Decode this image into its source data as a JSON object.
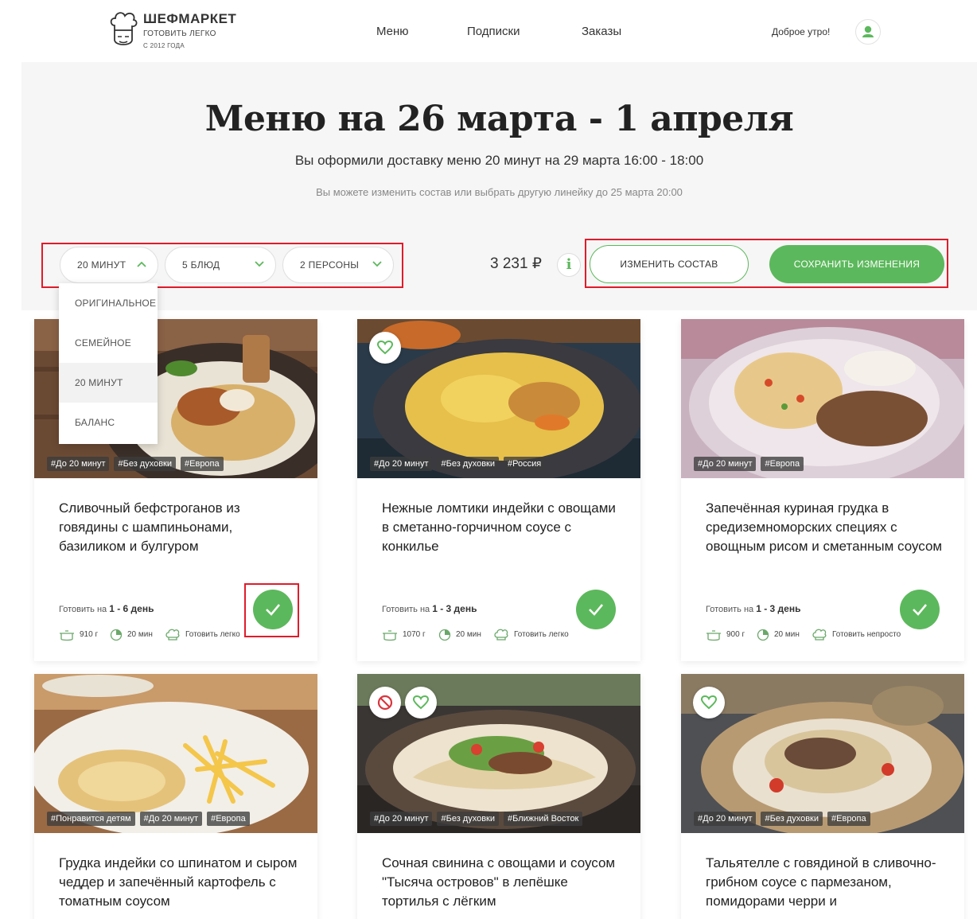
{
  "header": {
    "logo": {
      "name": "ШЕФМАРКЕТ",
      "tagline": "ГОТОВИТЬ ЛЕГКО",
      "since": "С 2012 ГОДА"
    },
    "nav": [
      {
        "label": "Меню"
      },
      {
        "label": "Подписки"
      },
      {
        "label": "Заказы"
      }
    ],
    "greeting": "Доброе утро!"
  },
  "hero": {
    "title": "Меню на 26 марта - 1 апреля",
    "delivery_text": "Вы оформили доставку меню 20 минут на 29 марта 16:00 - 18:00",
    "deadline_text": "Вы можете изменить состав или выбрать другую линейку до 25 марта 20:00"
  },
  "controls": {
    "menu_line": "20 МИНУТ",
    "dishes": "5 БЛЮД",
    "persons": "2 ПЕРСОНЫ",
    "price": "3 231 ₽",
    "info_label": "i",
    "change_button": "ИЗМЕНИТЬ СОСТАВ",
    "save_button": "СОХРАНИТЬ ИЗМЕНЕНИЯ"
  },
  "dropdown": {
    "options": [
      "ОРИГИНАЛЬНОЕ",
      "СЕМЕЙНОЕ",
      "20 МИНУТ",
      "БАЛАНС"
    ],
    "selected": "20 МИНУТ"
  },
  "cards": [
    {
      "title": "Сливочный бефстроганов из говядины с шампиньонами, базиликом и булгуром",
      "tags": [
        "#До 20 минут",
        "#Без духовки",
        "#Европа"
      ],
      "cook_prefix": "Готовить на ",
      "cook_days": "1 - 6 день",
      "weight": "910 г",
      "time": "20 мин",
      "difficulty": "Готовить легко",
      "selected": true
    },
    {
      "title": "Нежные ломтики индейки с овощами в сметанно-горчичном соусе с конкилье",
      "tags": [
        "#До 20 минут",
        "#Без духовки",
        "#Россия"
      ],
      "cook_prefix": "Готовить на ",
      "cook_days": "1 - 3 день",
      "weight": "1070 г",
      "time": "20 мин",
      "difficulty": "Готовить легко",
      "selected": true
    },
    {
      "title": "Запечённая куриная грудка в средиземноморских специях с овощным рисом и сметанным соусом",
      "tags": [
        "#До 20 минут",
        "#Европа"
      ],
      "cook_prefix": "Готовить на ",
      "cook_days": "1 - 3 день",
      "weight": "900 г",
      "time": "20 мин",
      "difficulty": "Готовить непросто",
      "selected": true
    },
    {
      "title": "Грудка индейки со шпинатом и сыром чеддер и запечённый картофель с томатным соусом",
      "tags": [
        "#Понравится детям",
        "#До 20 минут",
        "#Европа"
      ]
    },
    {
      "title": "Сочная свинина с овощами и соусом \"Тысяча островов\" в лепёшке тортилья с лёгким",
      "tags": [
        "#До 20 минут",
        "#Без духовки",
        "#Ближний Восток"
      ]
    },
    {
      "title": "Тальятелле с говядиной в сливочно-грибном соусе с пармезаном, помидорами черри и",
      "tags": [
        "#До 20 минут",
        "#Без духовки",
        "#Европа"
      ]
    }
  ],
  "colors": {
    "accent": "#5cb85c",
    "annotation": "#e11b2a",
    "hero_bg": "#f6f6f6"
  }
}
